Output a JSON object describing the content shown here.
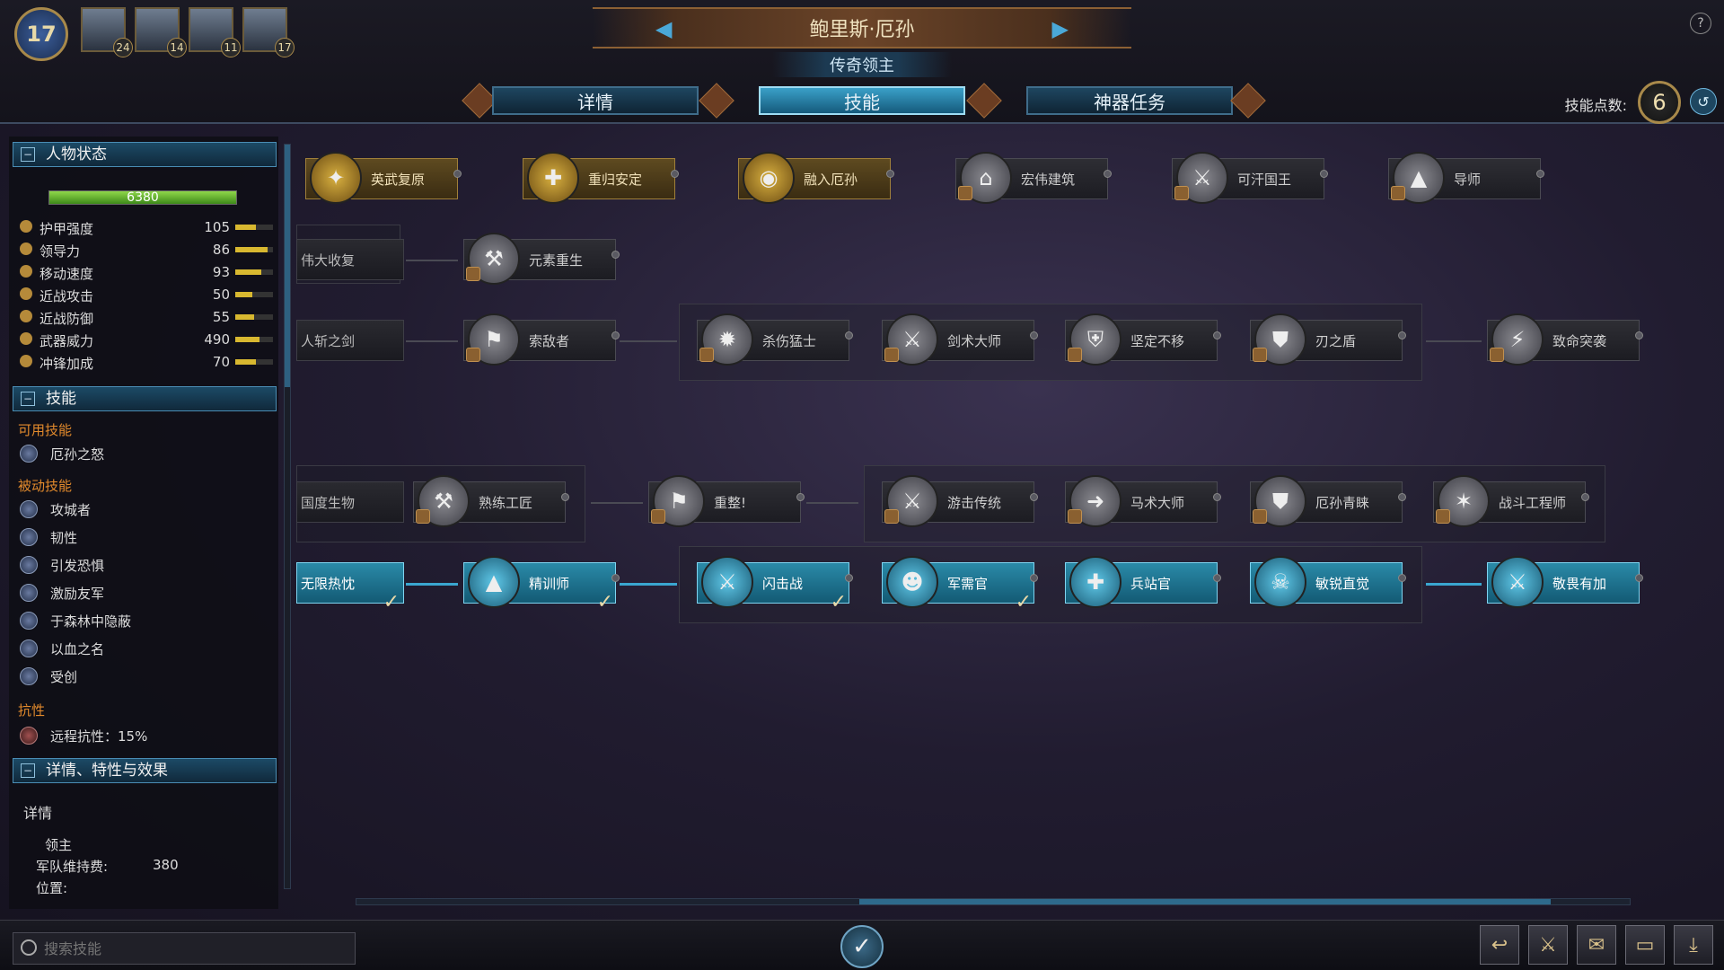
{
  "header": {
    "level": "17",
    "lord_name": "鲍里斯·厄孙",
    "subtitle": "传奇领主",
    "help": "?",
    "portraits": [
      "24",
      "14",
      "11",
      "17"
    ],
    "tabs": [
      "详情",
      "技能",
      "神器任务"
    ],
    "skill_points_label": "技能点数:",
    "skill_points": "6"
  },
  "left": {
    "char_status_title": "人物状态",
    "hp": "6380",
    "stats": [
      {
        "label": "护甲强度",
        "value": "105",
        "fill": 0.55
      },
      {
        "label": "领导力",
        "value": "86",
        "fill": 0.85
      },
      {
        "label": "移动速度",
        "value": "93",
        "fill": 0.7
      },
      {
        "label": "近战攻击",
        "value": "50",
        "fill": 0.45
      },
      {
        "label": "近战防御",
        "value": "55",
        "fill": 0.5
      },
      {
        "label": "武器威力",
        "value": "490",
        "fill": 0.65
      },
      {
        "label": "冲锋加成",
        "value": "70",
        "fill": 0.55
      }
    ],
    "abilities_title": "技能",
    "available_label": "可用技能",
    "available": [
      "厄孙之怒"
    ],
    "passive_label": "被动技能",
    "passive": [
      "攻城者",
      "韧性",
      "引发恐惧",
      "激励友军",
      "于森林中隐蔽",
      "以血之名",
      "受创"
    ],
    "resist_label": "抗性",
    "resist": "远程抗性：15%",
    "details_title": "详情、特性与效果",
    "details_label": "详情",
    "detail_lines": [
      "领主",
      "军队维持费:",
      "380",
      "位置:"
    ]
  },
  "tree": {
    "row1": [
      "英武复原",
      "重归安定",
      "融入厄孙",
      "宏伟建筑",
      "可汗国王",
      "导师"
    ],
    "row2_partial": "伟大收复",
    "row2": [
      "元素重生"
    ],
    "row3_partial": "人斩之剑",
    "row3": [
      "索敌者",
      "杀伤猛士",
      "剑术大师",
      "坚定不移",
      "刃之盾",
      "致命突袭"
    ],
    "row4_partial": "国度生物",
    "row4": [
      "熟练工匠",
      "重整!",
      "游击传统",
      "马术大师",
      "厄孙青睐",
      "战斗工程师"
    ],
    "row5_partial": "无限热忱",
    "row5": [
      "精训师",
      "闪击战",
      "军需官",
      "兵站官",
      "敏锐直觉",
      "敬畏有加"
    ]
  },
  "search": {
    "placeholder": "搜索技能"
  }
}
